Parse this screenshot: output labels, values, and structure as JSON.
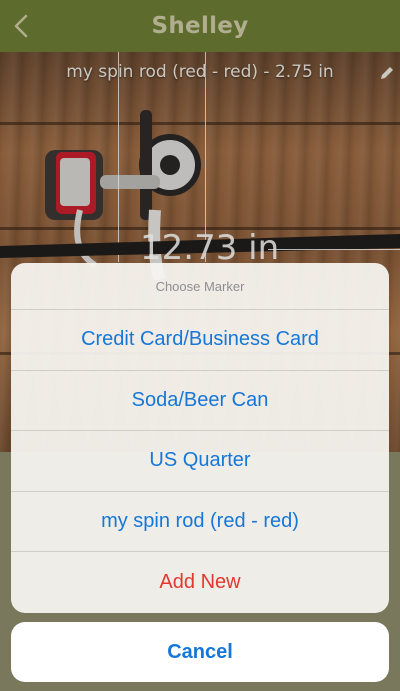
{
  "navbar": {
    "title": "Shelley",
    "back_icon": "chevron-left-icon"
  },
  "photo": {
    "label": "my spin rod (red - red) - 2.75 in",
    "edit_icon": "pencil-icon",
    "measurement": "12.73 in"
  },
  "action_sheet": {
    "title": "Choose Marker",
    "options": [
      {
        "label": "Credit Card/Business Card"
      },
      {
        "label": "Soda/Beer Can"
      },
      {
        "label": "US Quarter"
      },
      {
        "label": "my spin rod (red - red)"
      },
      {
        "label": "Add New",
        "style": "destructive"
      }
    ],
    "cancel_label": "Cancel"
  },
  "colors": {
    "navbar": "#6a7a34",
    "title": "#c9c6a3",
    "action_blue": "#1577d9",
    "action_red": "#e5362f"
  }
}
